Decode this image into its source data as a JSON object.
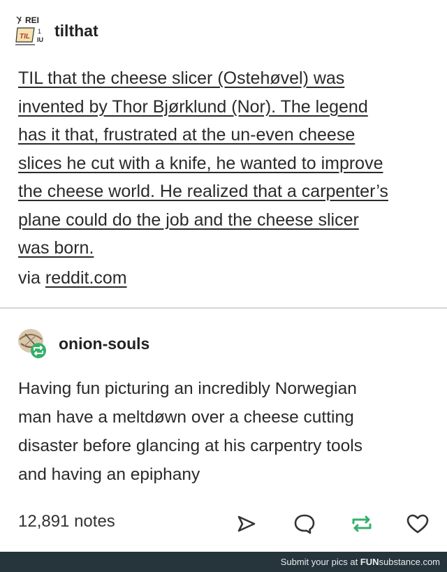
{
  "post": {
    "author1": "tilthat",
    "avatar1_text": {
      "top": "REI",
      "side": "1",
      "bottom": "IU",
      "mid": "TIL"
    },
    "text1_lines": [
      "TIL that the cheese slicer (Ostehøvel) was",
      "invented by Thor Bjørklund (Nor). The legend",
      "has it that, frustrated at the un-even cheese",
      "slices he cut with a knife, he wanted to improve",
      "the cheese world. He realized that a carpenter’s",
      "plane could do the job and the cheese slicer",
      "was born."
    ],
    "via_prefix": "via ",
    "via_link": "reddit.com",
    "author2": "onion-souls",
    "text2_lines": [
      "Having fun picturing an incredibly Norwegian",
      "man have a meltdøwn over a cheese cutting",
      "disaster before glancing at his carpentry tools",
      "and having an epiphany"
    ],
    "notes": "12,891 notes",
    "actions": [
      "share-icon",
      "reply-icon",
      "reblog-icon",
      "like-icon"
    ],
    "reblog_color": "#34b06b"
  },
  "watermark": {
    "prefix": "Submit your pics at ",
    "brand_bold": "FUN",
    "brand_rest": "substance",
    "suffix": ".com"
  }
}
